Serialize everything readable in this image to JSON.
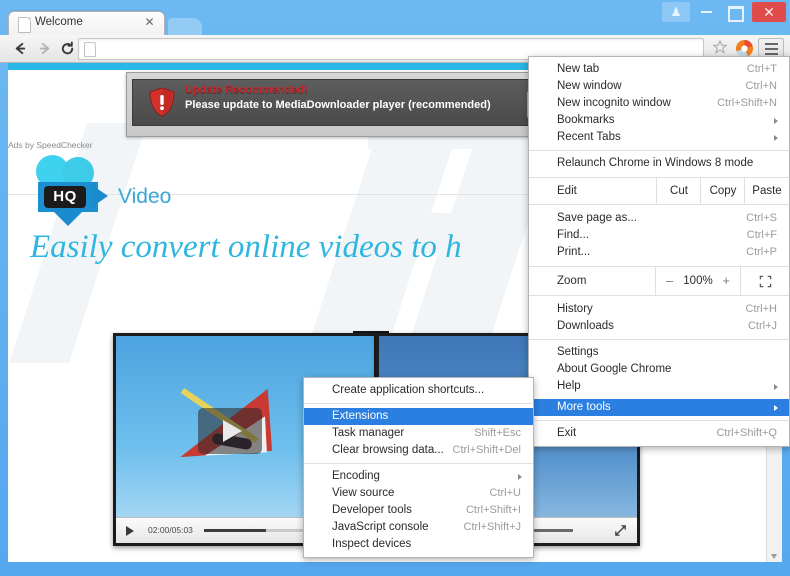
{
  "window": {
    "controls": [
      {
        "name": "user-profile-button",
        "glyph": "♟"
      },
      {
        "name": "minimize-button",
        "glyph": ""
      },
      {
        "name": "maximize-button",
        "glyph": ""
      },
      {
        "name": "close-button",
        "glyph": "✕"
      }
    ]
  },
  "tabstrip": {
    "tab_title": "Welcome",
    "close_glyph": "✕"
  },
  "toolbar": {
    "back_label": "Back",
    "forward_label": "Forward",
    "reload_label": "Reload",
    "omnibox_value": "",
    "omnibox_placeholder": "",
    "star_label": "Bookmark this page",
    "extension_label": "Extension",
    "menu_label": "Customize and control Google Chrome"
  },
  "page": {
    "ad": {
      "title": "Update Recommended!",
      "subtitle": "Please update to MediaDownloader player (recommended)",
      "button_label": "",
      "credit": "Ads by SpeedChecker"
    },
    "logo": {
      "badge": "HQ",
      "text": "Video"
    },
    "headline": "Easily convert online videos to h",
    "player": {
      "time": "02:00/05:03",
      "play_label": "Play",
      "seek_label": "Seek",
      "volume_label": "Volume",
      "fullscreen_label": "Fullscreen"
    },
    "player2": {
      "seek_label": "Seek",
      "volume_label": "Volume",
      "fullscreen_label": "Fullscreen"
    }
  },
  "chrome_menu": {
    "items": [
      {
        "label": "New tab",
        "accel": "Ctrl+T",
        "type": "item"
      },
      {
        "label": "New window",
        "accel": "Ctrl+N",
        "type": "item"
      },
      {
        "label": "New incognito window",
        "accel": "Ctrl+Shift+N",
        "type": "item"
      },
      {
        "label": "Bookmarks",
        "accel": "",
        "type": "submenu"
      },
      {
        "label": "Recent Tabs",
        "accel": "",
        "type": "submenu"
      },
      {
        "type": "separator"
      },
      {
        "label": "Relaunch Chrome in Windows 8 mode",
        "accel": "",
        "type": "item"
      }
    ],
    "edit_row": {
      "label": "Edit",
      "cut": "Cut",
      "copy": "Copy",
      "paste": "Paste"
    },
    "items2": [
      {
        "label": "Save page as...",
        "accel": "Ctrl+S",
        "type": "item"
      },
      {
        "label": "Find...",
        "accel": "Ctrl+F",
        "type": "item"
      },
      {
        "label": "Print...",
        "accel": "Ctrl+P",
        "type": "item"
      }
    ],
    "zoom_row": {
      "label": "Zoom",
      "minus": "–",
      "value": "100%",
      "plus": "+"
    },
    "items3": [
      {
        "label": "History",
        "accel": "Ctrl+H",
        "type": "item"
      },
      {
        "label": "Downloads",
        "accel": "Ctrl+J",
        "type": "item"
      },
      {
        "type": "separator"
      },
      {
        "label": "Settings",
        "accel": "",
        "type": "item"
      },
      {
        "label": "About Google Chrome",
        "accel": "",
        "type": "item"
      },
      {
        "label": "Help",
        "accel": "",
        "type": "submenu"
      },
      {
        "label": "More tools",
        "accel": "",
        "type": "submenu",
        "selected": true
      },
      {
        "type": "separator"
      },
      {
        "label": "Exit",
        "accel": "Ctrl+Shift+Q",
        "type": "item"
      }
    ]
  },
  "more_tools_menu": {
    "items": [
      {
        "label": "Create application shortcuts...",
        "accel": "",
        "type": "item"
      },
      {
        "type": "separator"
      },
      {
        "label": "Extensions",
        "accel": "",
        "type": "item",
        "selected": true
      },
      {
        "label": "Task manager",
        "accel": "Shift+Esc",
        "type": "item"
      },
      {
        "label": "Clear browsing data...",
        "accel": "Ctrl+Shift+Del",
        "type": "item"
      },
      {
        "type": "separator"
      },
      {
        "label": "Encoding",
        "accel": "",
        "type": "submenu"
      },
      {
        "label": "View source",
        "accel": "Ctrl+U",
        "type": "item"
      },
      {
        "label": "Developer tools",
        "accel": "Ctrl+Shift+I",
        "type": "item"
      },
      {
        "label": "JavaScript console",
        "accel": "Ctrl+Shift+J",
        "type": "item"
      },
      {
        "label": "Inspect devices",
        "accel": "",
        "type": "item"
      }
    ]
  },
  "colors": {
    "window_frame": "#5aaef0",
    "accent_bar": "#29b6e8",
    "menu_highlight": "#2a7fe0",
    "ad_title": "#c4242a",
    "headline": "#2fb6e0",
    "close_button": "#e04b4b"
  }
}
